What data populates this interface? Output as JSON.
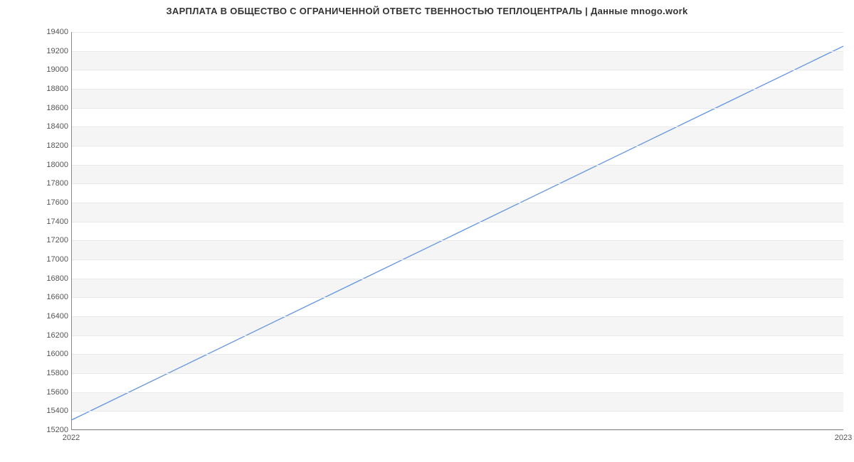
{
  "chart_data": {
    "type": "line",
    "title": "ЗАРПЛАТА В ОБЩЕСТВО С ОГРАНИЧЕННОЙ ОТВЕТС ТВЕННОСТЬЮ ТЕПЛОЦЕНТРАЛЬ | Данные mnogo.work",
    "xlabel": "",
    "ylabel": "",
    "x": [
      2022,
      2023
    ],
    "y": [
      15300,
      19250
    ],
    "x_ticks": [
      "2022",
      "2023"
    ],
    "y_ticks": [
      15200,
      15400,
      15600,
      15800,
      16000,
      16200,
      16400,
      16600,
      16800,
      17000,
      17200,
      17400,
      17600,
      17800,
      18000,
      18200,
      18400,
      18600,
      18800,
      19000,
      19200,
      19400
    ],
    "xlim": [
      2022,
      2023
    ],
    "ylim": [
      15200,
      19400
    ],
    "line_color": "#6b9ae0",
    "band_color": "#f5f5f5"
  }
}
